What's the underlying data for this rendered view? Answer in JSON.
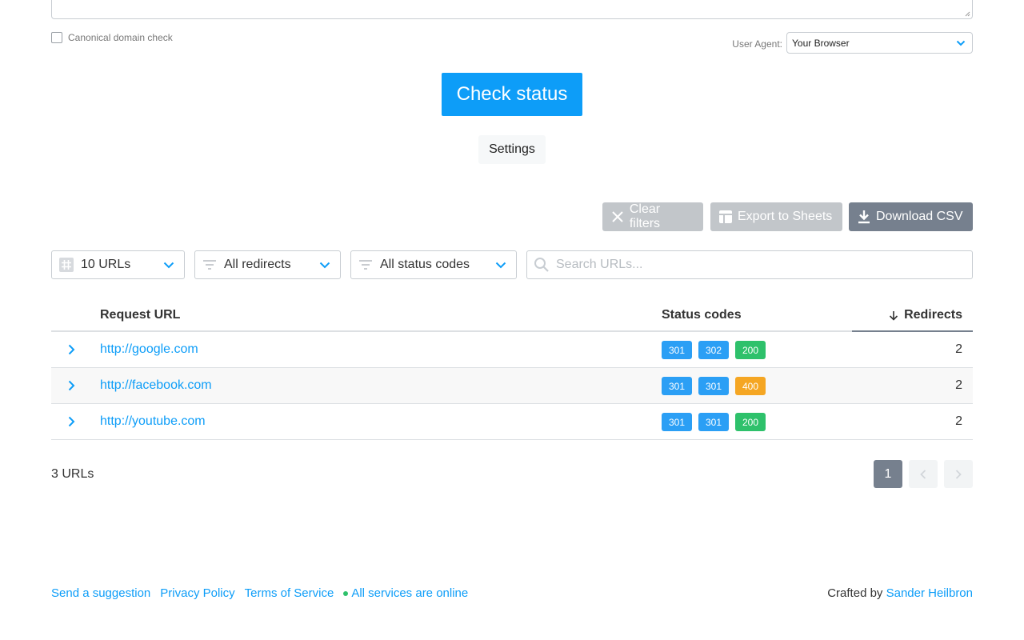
{
  "form": {
    "canonical_label": "Canonical domain check",
    "user_agent_label": "User Agent:",
    "user_agent_value": "Your Browser",
    "check_button": "Check status",
    "settings_button": "Settings"
  },
  "actions": {
    "clear_filters": "Clear filters",
    "export_sheets": "Export to Sheets",
    "download_csv": "Download CSV"
  },
  "filters": {
    "urls": "10 URLs",
    "redirects": "All redirects",
    "status_codes": "All status codes",
    "search_placeholder": "Search URLs..."
  },
  "table": {
    "headers": {
      "request_url": "Request URL",
      "status_codes": "Status codes",
      "redirects": "Redirects"
    },
    "rows": [
      {
        "url": "http://google.com",
        "codes": [
          "301",
          "302",
          "200"
        ],
        "redirects": "2"
      },
      {
        "url": "http://facebook.com",
        "codes": [
          "301",
          "301",
          "400"
        ],
        "redirects": "2"
      },
      {
        "url": "http://youtube.com",
        "codes": [
          "301",
          "301",
          "200"
        ],
        "redirects": "2"
      }
    ]
  },
  "code_colors": {
    "301": "#2b9ff5",
    "302": "#2b9ff5",
    "200": "#2ec16b",
    "400": "#f5a623"
  },
  "summary": {
    "count": "3 URLs",
    "current_page": "1"
  },
  "footer": {
    "send_suggestion": "Send a suggestion",
    "privacy": "Privacy Policy",
    "terms": "Terms of Service",
    "services_status": "All services are online",
    "crafted_by": "Crafted by",
    "author": "Sander Heilbron"
  },
  "colors": {
    "accent": "#0d9df8",
    "dark_button": "#76808e",
    "disabled_button": "#c2c6ca",
    "online": "#2ec16b"
  }
}
